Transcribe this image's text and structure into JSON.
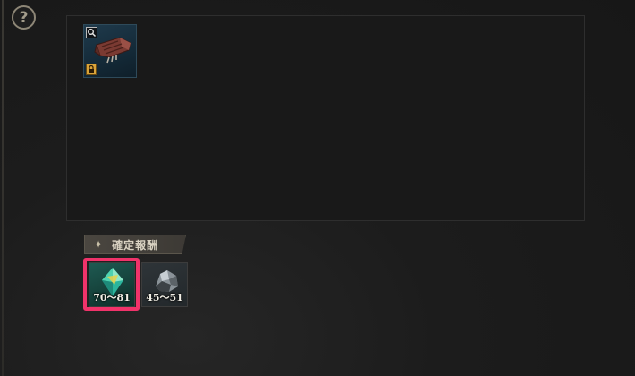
{
  "help": {
    "symbol": "?"
  },
  "item_panel": {
    "items": [
      {
        "icon": "gear-gauntlet-icon",
        "locked": true
      }
    ]
  },
  "reward_section": {
    "title": "確定報酬",
    "star": "✦",
    "rewards": [
      {
        "icon": "crystal-icon",
        "range": "70～81",
        "highlighted": true
      },
      {
        "icon": "ore-icon",
        "range": "45～51",
        "highlighted": false
      }
    ]
  },
  "colors": {
    "highlight": "#f0336a",
    "lock_badge": "#d9a43a"
  }
}
